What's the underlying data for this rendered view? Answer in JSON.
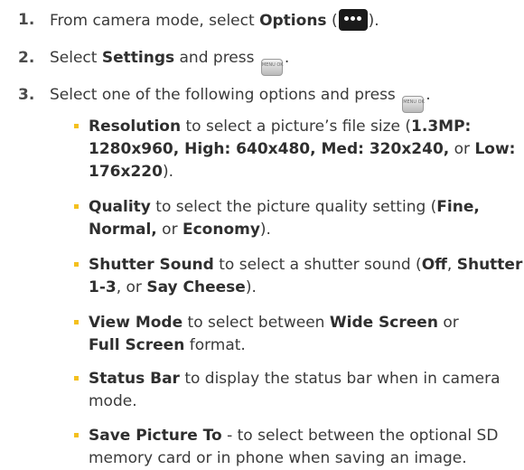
{
  "steps": [
    {
      "num": "1.",
      "pre": "From camera mode, select ",
      "bold": "Options",
      "mid": " (",
      "post": ")."
    },
    {
      "num": "2.",
      "pre": "Select ",
      "bold": "Settings",
      "post": " and press "
    },
    {
      "num": "3.",
      "text": "Select one of the following options and press "
    }
  ],
  "key_label": "MENU OK",
  "bullets": [
    {
      "lines": [
        [
          {
            "b": "Resolution"
          },
          {
            "t": " to select a picture’s file size ("
          },
          {
            "b": "1.3MP:"
          }
        ],
        [
          {
            "b": "1280x960, High: 640x480, Med: 320x240,"
          },
          {
            "t": " or "
          },
          {
            "b": "Low:"
          }
        ],
        [
          {
            "b": "176x220"
          },
          {
            "t": ")."
          }
        ]
      ]
    },
    {
      "lines": [
        [
          {
            "b": "Quality"
          },
          {
            "t": " to select the picture quality setting ("
          },
          {
            "b": "Fine,"
          }
        ],
        [
          {
            "b": "Normal,"
          },
          {
            "t": " or "
          },
          {
            "b": "Economy"
          },
          {
            "t": ")."
          }
        ]
      ]
    },
    {
      "lines": [
        [
          {
            "b": "Shutter Sound"
          },
          {
            "t": " to select a shutter sound ("
          },
          {
            "b": "Off"
          },
          {
            "t": ", "
          },
          {
            "b": "Shutter"
          }
        ],
        [
          {
            "b": "1-3"
          },
          {
            "t": ", or "
          },
          {
            "b": "Say Cheese"
          },
          {
            "t": ")."
          }
        ]
      ]
    },
    {
      "lines": [
        [
          {
            "b": "View Mode"
          },
          {
            "t": " to select between "
          },
          {
            "b": "Wide Screen"
          },
          {
            "t": " or"
          }
        ],
        [
          {
            "b": "Full Screen"
          },
          {
            "t": " format."
          }
        ]
      ]
    },
    {
      "lines": [
        [
          {
            "b": "Status Bar"
          },
          {
            "t": " to display the status bar when in camera"
          }
        ],
        [
          {
            "t": "mode."
          }
        ]
      ]
    },
    {
      "lines": [
        [
          {
            "b": "Save Picture To"
          },
          {
            "t": " - to select between the optional SD"
          }
        ],
        [
          {
            "t": "memory card or in phone when saving an image."
          }
        ]
      ]
    }
  ],
  "colors": {
    "text": "#3a3a3a",
    "bullet": "#f4c01e",
    "options_icon_bg": "#1a1a1a"
  },
  "icons": {
    "options": "options-dots-icon",
    "menu_ok": "menu-ok-key-icon"
  }
}
